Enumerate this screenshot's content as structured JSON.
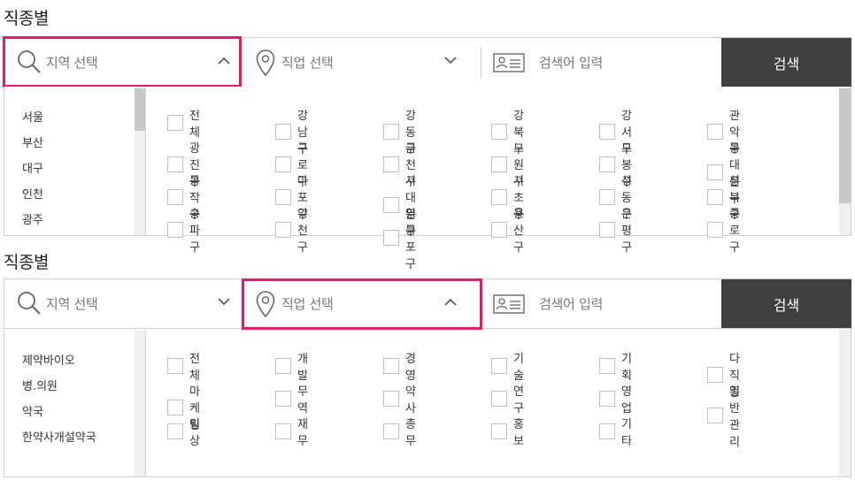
{
  "sections": [
    {
      "title": "직종별",
      "region_placeholder": "지역 선택",
      "job_placeholder": "직업 선택",
      "keyword_placeholder": "검색어 입력",
      "search_label": "검색",
      "left_items": [
        "서울",
        "부산",
        "대구",
        "인천",
        "광주"
      ],
      "options": [
        [
          "전체",
          "강남구",
          "강동구",
          "강북구",
          "강서구",
          "관악구"
        ],
        [
          "광진구",
          "구로구",
          "금천구",
          "노원구",
          "도봉구",
          "동대문구"
        ],
        [
          "동작구",
          "마포구",
          "서대문구",
          "서초구",
          "성동구",
          "성북구"
        ],
        [
          "송파구",
          "양천구",
          "영등포구",
          "용산구",
          "은평구",
          "종로구"
        ]
      ]
    },
    {
      "title": "직종별",
      "region_placeholder": "지역 선택",
      "job_placeholder": "직업 선택",
      "keyword_placeholder": "검색어 입력",
      "search_label": "검색",
      "left_items": [
        "제약바이오",
        "병.의원",
        "약국",
        "한약사개설약국"
      ],
      "options": [
        [
          "전체",
          "개발",
          "경영",
          "기술",
          "기획",
          "다직종"
        ],
        [
          "마케팅",
          "무역",
          "약사",
          "연구",
          "영업",
          "일반관리"
        ],
        [
          "임상",
          "재무",
          "총무",
          "홍보",
          "기타"
        ]
      ]
    }
  ],
  "colors": {
    "highlight": "#e8186b",
    "search_button": "#3f3f3f"
  },
  "icons": [
    "search-icon",
    "location-pin-icon",
    "id-card-icon",
    "chevron-up-icon",
    "chevron-down-icon"
  ]
}
